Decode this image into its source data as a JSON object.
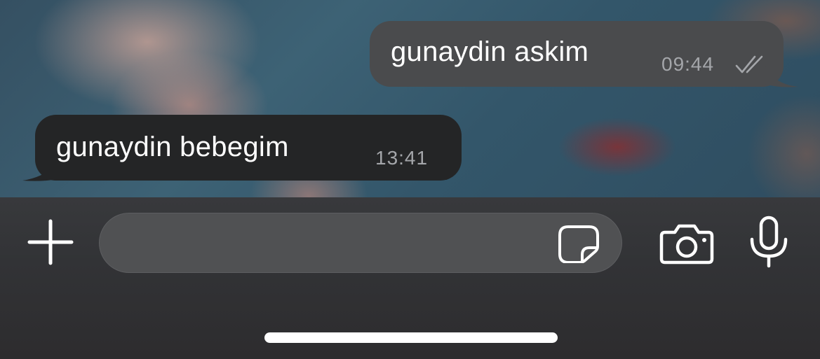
{
  "messages": [
    {
      "direction": "outgoing",
      "text": "gunaydin askim",
      "time": "09:44",
      "status_icon": "double-check-icon"
    },
    {
      "direction": "incoming",
      "text": "gunaydin bebegim",
      "time": "13:41"
    }
  ],
  "composer": {
    "placeholder": "",
    "attach_icon": "plus-icon",
    "sticker_icon": "sticker-icon",
    "camera_icon": "camera-icon",
    "mic_icon": "microphone-icon"
  },
  "colors": {
    "outgoing_bubble": "#4a4b4d",
    "incoming_bubble": "#242526",
    "timestamp": "#a4a6aa",
    "input_bar": "#333437",
    "text_field": "#505153"
  }
}
